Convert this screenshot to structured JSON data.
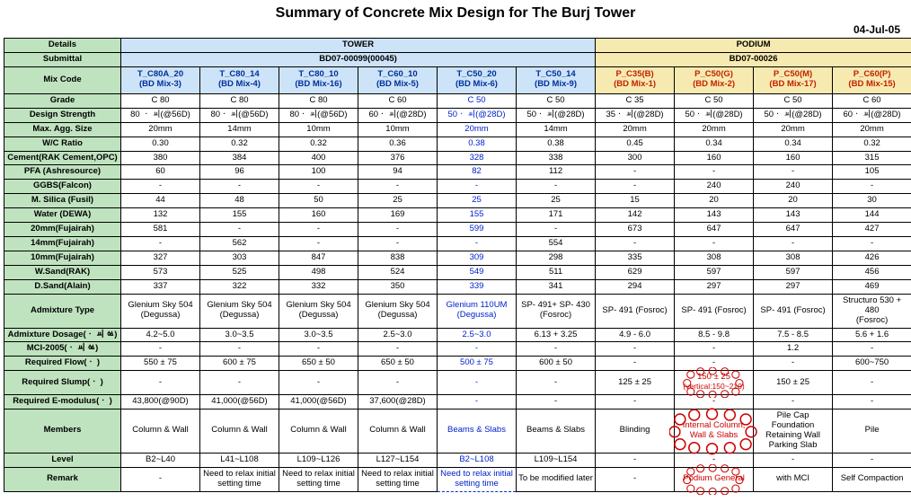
{
  "title": "Summary of Concrete Mix Design for The Burj Tower",
  "date": "04-Jul-05",
  "headers": {
    "details": "Details",
    "tower": "TOWER",
    "podium": "PODIUM",
    "submittal": "Submittal",
    "tower_sub": "BD07-00099(00045)",
    "podium_sub": "BD07-00026",
    "mixcode": "Mix Code"
  },
  "mixcols": [
    {
      "code": "T_C80A_20",
      "bd": "(BD Mix-3)",
      "cls": "mix-blue"
    },
    {
      "code": "T_C80_14",
      "bd": "(BD Mix-4)",
      "cls": "mix-blue"
    },
    {
      "code": "T_C80_10",
      "bd": "(BD Mix-16)",
      "cls": "mix-blue"
    },
    {
      "code": "T_C60_10",
      "bd": "(BD Mix-5)",
      "cls": "mix-blue"
    },
    {
      "code": "T_C50_20",
      "bd": "(BD Mix-6)",
      "cls": "mix-blue"
    },
    {
      "code": "T_C50_14",
      "bd": "(BD Mix-9)",
      "cls": "mix-blue"
    },
    {
      "code": "P_C35(B)",
      "bd": "(BD Mix-1)",
      "cls": "mix-yellow"
    },
    {
      "code": "P_C50(G)",
      "bd": "(BD Mix-2)",
      "cls": "mix-yellow"
    },
    {
      "code": "P_C50(M)",
      "bd": "(BD Mix-17)",
      "cls": "mix-yellow"
    },
    {
      "code": "P_C60(P)",
      "bd": "(BD Mix-15)",
      "cls": "mix-yellow"
    }
  ],
  "rows": [
    {
      "label": "Grade",
      "v": [
        "C 80",
        "C 80",
        "C 80",
        "C 60",
        "C 50",
        "C 50",
        "C 35",
        "C 50",
        "C 50",
        "C 60"
      ]
    },
    {
      "label": "Design Strength",
      "v": [
        "80 ㆍ ㆉ(@56D)",
        "80ㆍ ㆉ(@56D)",
        "80ㆍ ㆉ(@56D)",
        "60ㆍ ㆉ(@28D)",
        "50ㆍ ㆉ(@28D)",
        "50ㆍ ㆉ(@28D)",
        "35ㆍ ㆉ(@28D)",
        "50ㆍ ㆉ(@28D)",
        "50ㆍ ㆉ(@28D)",
        "60ㆍ ㆉ(@28D)"
      ]
    },
    {
      "label": "Max. Agg. Size",
      "v": [
        "20mm",
        "14mm",
        "10mm",
        "10mm",
        "20mm",
        "14mm",
        "20mm",
        "20mm",
        "20mm",
        "20mm"
      ]
    },
    {
      "label": "W/C Ratio",
      "v": [
        "0.30",
        "0.32",
        "0.32",
        "0.36",
        "0.38",
        "0.38",
        "0.45",
        "0.34",
        "0.34",
        "0.32"
      ]
    },
    {
      "label": "Cement(RAK Cement,OPC)",
      "v": [
        "380",
        "384",
        "400",
        "376",
        "328",
        "338",
        "300",
        "160",
        "160",
        "315"
      ]
    },
    {
      "label": "PFA (Ashresource)",
      "v": [
        "60",
        "96",
        "100",
        "94",
        "82",
        "112",
        "-",
        "-",
        "-",
        "105"
      ]
    },
    {
      "label": "GGBS(Falcon)",
      "v": [
        "-",
        "-",
        "-",
        "-",
        "-",
        "-",
        "-",
        "240",
        "240",
        "-"
      ]
    },
    {
      "label": "M. Silica (Fusil)",
      "v": [
        "44",
        "48",
        "50",
        "25",
        "25",
        "25",
        "15",
        "20",
        "20",
        "30"
      ]
    },
    {
      "label": "Water (DEWA)",
      "v": [
        "132",
        "155",
        "160",
        "169",
        "155",
        "171",
        "142",
        "143",
        "143",
        "144"
      ]
    },
    {
      "label": "20mm(Fujairah)",
      "v": [
        "581",
        "-",
        "-",
        "-",
        "599",
        "-",
        "673",
        "647",
        "647",
        "427"
      ]
    },
    {
      "label": "14mm(Fujairah)",
      "v": [
        "-",
        "562",
        "-",
        "-",
        "-",
        "554",
        "-",
        "-",
        "-",
        "-"
      ]
    },
    {
      "label": "10mm(Fujairah)",
      "v": [
        "327",
        "303",
        "847",
        "838",
        "309",
        "298",
        "335",
        "308",
        "308",
        "426"
      ]
    },
    {
      "label": "W.Sand(RAK)",
      "v": [
        "573",
        "525",
        "498",
        "524",
        "549",
        "511",
        "629",
        "597",
        "597",
        "456"
      ]
    },
    {
      "label": "D.Sand(Alain)",
      "v": [
        "337",
        "322",
        "332",
        "350",
        "339",
        "341",
        "294",
        "297",
        "297",
        "469"
      ]
    },
    {
      "label": "Admixture Type",
      "v": [
        "Glenium Sky 504 (Degussa)",
        "Glenium Sky 504 (Degussa)",
        "Glenium Sky 504 (Degussa)",
        "Glenium Sky 504 (Degussa)",
        "Glenium 110UM (Degussa)",
        "SP- 491+ SP- 430 (Fosroc)",
        "SP- 491 (Fosroc)",
        "SP- 491 (Fosroc)",
        "SP- 491 (Fosroc)",
        "Structuro 530 + 480 (Fosroc)"
      ]
    },
    {
      "label": "Admixture Dosage(ㆍ ㆉ  ㆃ)",
      "v": [
        "4.2~5.0",
        "3.0~3.5",
        "3.0~3.5",
        "2.5~3.0",
        "2.5~3.0",
        "6.13 + 3.25",
        "4.9 - 6.0",
        "8.5 - 9.8",
        "7.5 - 8.5",
        "5.6 + 1.6"
      ]
    },
    {
      "label": "MCI-2005(ㆍ ㆉ  ㆃ)",
      "v": [
        "-",
        "-",
        "-",
        "-",
        "-",
        "-",
        "-",
        "-",
        "1.2",
        "-"
      ]
    },
    {
      "label": "Required Flow(ㆍ )",
      "v": [
        "550 ± 75",
        "600 ± 75",
        "650 ± 50",
        "650 ± 50",
        "500 ± 75",
        "600 ± 50",
        "-",
        "-",
        "-",
        "600~750"
      ]
    },
    {
      "label": "Required Slump(ㆍ )",
      "v": [
        "-",
        "-",
        "-",
        "-",
        "-",
        "-",
        "125 ± 25",
        "150 ± 25 (vertical:150~210)",
        "150 ± 25",
        "-"
      ]
    },
    {
      "label": "Required E-modulus(ㆍ )",
      "v": [
        "43,800(@90D)",
        "41,000(@56D)",
        "41,000(@56D)",
        "37,600(@28D)",
        "-",
        "-",
        "-",
        "-",
        "-",
        "-"
      ]
    },
    {
      "label": "Members",
      "v": [
        "Column & Wall",
        "Column & Wall",
        "Column & Wall",
        "Column & Wall",
        "Beams & Slabs",
        "Beams & Slabs",
        "Blinding",
        "Internal Column, Wall & Slabs",
        "Pile Cap Foundation Retaining Wall Parking Slab",
        "Pile"
      ]
    },
    {
      "label": "Level",
      "v": [
        "B2~L40",
        "L41~L108",
        "L109~L126",
        "L127~L154",
        "B2~L108",
        "L109~L154",
        "-",
        "-",
        "-",
        "-"
      ]
    },
    {
      "label": "Remark",
      "v": [
        "-",
        "Need to relax initial setting time",
        "Need to relax initial setting time",
        "Need to relax initial setting time",
        "Need to relax initial setting time",
        "To be modified later",
        "-",
        "Podium General",
        "with MCI",
        "Self Compaction"
      ]
    }
  ],
  "chart_data": {
    "type": "table",
    "title": "Summary of Concrete Mix Design for The Burj Tower",
    "columns": [
      "T_C80A_20",
      "T_C80_14",
      "T_C80_10",
      "T_C60_10",
      "T_C50_20",
      "T_C50_14",
      "P_C35(B)",
      "P_C50(G)",
      "P_C50(M)",
      "P_C60(P)"
    ],
    "rows": [
      "Grade",
      "Design Strength",
      "Max. Agg. Size",
      "W/C Ratio",
      "Cement(RAK Cement,OPC)",
      "PFA (Ashresource)",
      "GGBS(Falcon)",
      "M. Silica (Fusil)",
      "Water (DEWA)",
      "20mm(Fujairah)",
      "14mm(Fujairah)",
      "10mm(Fujairah)",
      "W.Sand(RAK)",
      "D.Sand(Alain)",
      "Admixture Type",
      "Admixture Dosage",
      "MCI-2005",
      "Required Flow",
      "Required Slump",
      "Required E-modulus",
      "Members",
      "Level",
      "Remark"
    ]
  }
}
